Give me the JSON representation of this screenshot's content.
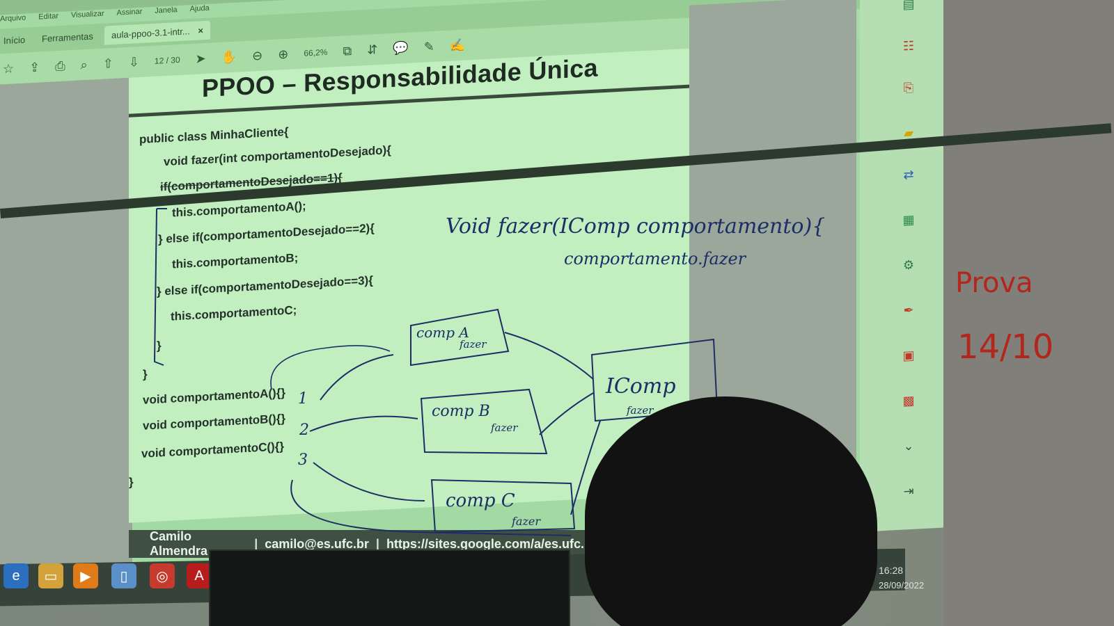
{
  "window": {
    "title_text": "aula-ppoo-3.1-intr...",
    "menu": [
      "Arquivo",
      "Editar",
      "Visualizar",
      "Assinar",
      "Janela",
      "Ajuda"
    ],
    "tabs": [
      "Início",
      "Ferramentas"
    ],
    "document_tab": "aula-ppoo-3.1-intr...",
    "tab_close": "×",
    "page_current": "12",
    "page_total": "/ 30",
    "zoom": "66,2%"
  },
  "slide": {
    "title": "PPOO – Responsabilidade Única",
    "code_lines": [
      "public class MinhaCliente{",
      "void fazer(int comportamentoDesejado){",
      "if(comportamentoDesejado==1){",
      "this.comportamentoA();",
      "} else if(comportamentoDesejado==2){",
      "this.comportamentoB;",
      "} else if(comportamentoDesejado==3){",
      "this.comportamentoC;",
      "}",
      "}",
      "void comportamentoA(){}",
      "void comportamentoB(){}",
      "void comportamentoC(){}",
      "}"
    ],
    "footer": {
      "author": "Camilo Almendra",
      "email": "camilo@es.ufc.br",
      "url": "https://sites.google.com/a/es.ufc.b"
    }
  },
  "annotations": {
    "handwritten_code_1": "Void fazer(IComp comportamento){",
    "handwritten_code_2": "comportamento.fazer",
    "box_a": "comp A",
    "box_a_sub": "fazer",
    "box_b": "comp B",
    "box_b_sub": "fazer",
    "box_c": "comp C",
    "box_c_sub": "fazer",
    "box_i": "IComp",
    "box_i_sub": "fazer",
    "numbers": [
      "1",
      "2",
      "3"
    ]
  },
  "whiteboard": {
    "word": "Prova",
    "date": "14/10"
  },
  "taskbar": {
    "time": "16:28",
    "date": "28/09/2022"
  },
  "colors": {
    "projection_green": "#c2efbf",
    "ink_blue": "#1d2d66",
    "marker_red": "#b2261c",
    "footer_bar": "#3f4f42"
  }
}
